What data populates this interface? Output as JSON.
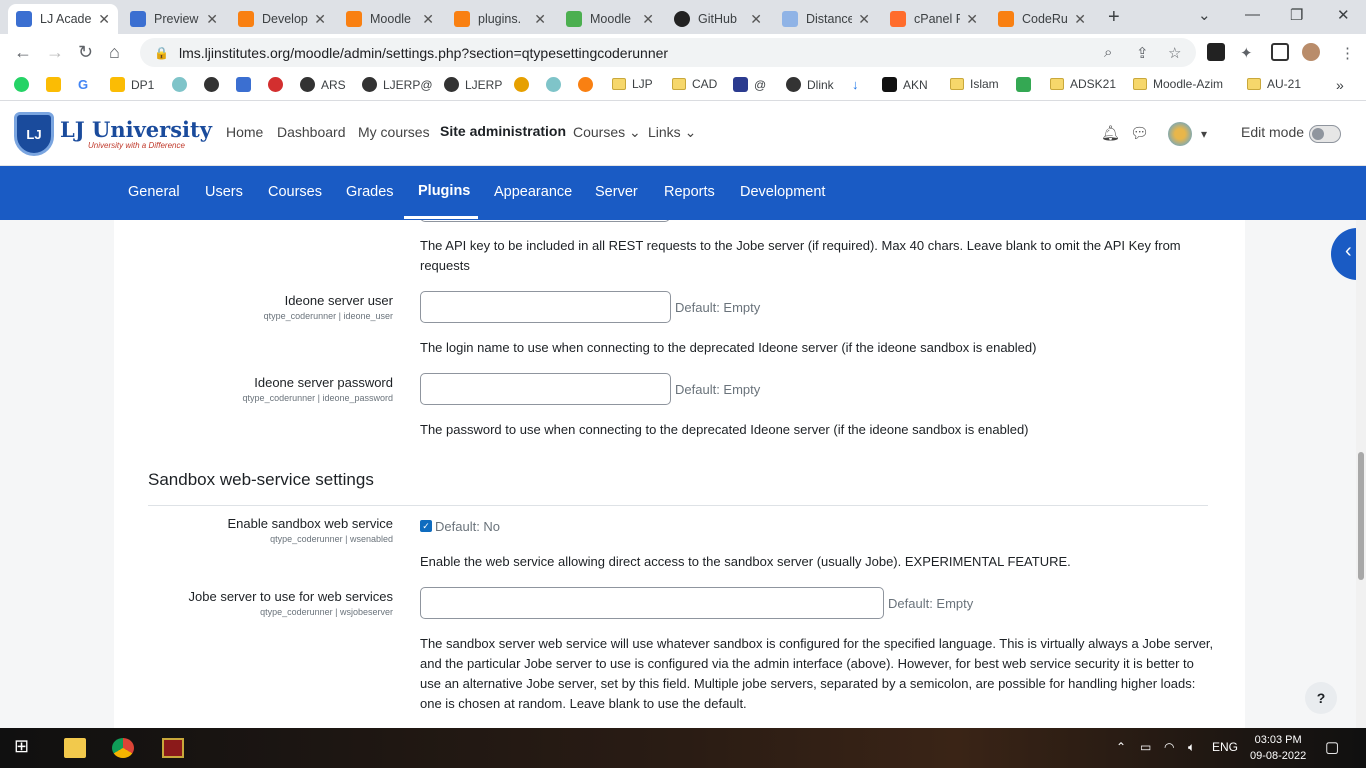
{
  "browser": {
    "tabs": [
      {
        "title": "LJ Acade",
        "active": true
      },
      {
        "title": "Preview"
      },
      {
        "title": "Develop"
      },
      {
        "title": "Moodle"
      },
      {
        "title": "plugins."
      },
      {
        "title": "Moodle"
      },
      {
        "title": "GitHub"
      },
      {
        "title": "Distance"
      },
      {
        "title": "cPanel F"
      },
      {
        "title": "CodeRu"
      }
    ],
    "url": "lms.ljinstitutes.org/moodle/admin/settings.php?section=qtypesettingcoderunner",
    "bookmarks": [
      "",
      "",
      "",
      "DP1",
      "",
      "",
      "",
      "",
      "ARS",
      "LJERP@",
      "LJERP",
      "",
      "",
      "",
      "LJP",
      "CAD",
      "@",
      "Dlink",
      "",
      "AKN",
      "Islam",
      "",
      "ADSK21",
      "Moodle-Azim",
      "AU-21"
    ]
  },
  "header": {
    "logo_name": "LJ University",
    "logo_tagline": "University with a Difference",
    "nav": [
      "Home",
      "Dashboard",
      "My courses",
      "Site administration",
      "Courses",
      "Links"
    ],
    "edit_mode_label": "Edit mode"
  },
  "secnav": [
    "General",
    "Users",
    "Courses",
    "Grades",
    "Plugins",
    "Appearance",
    "Server",
    "Reports",
    "Development"
  ],
  "settings": {
    "api_key_desc": "The API key to be included in all REST requests to the Jobe server (if required). Max 40 chars. Leave blank to omit the API Key from requests",
    "ideone_user": {
      "label": "Ideone server user",
      "sub": "qtype_coderunner | ideone_user",
      "default": "Default: Empty",
      "desc": "The login name to use when connecting to the deprecated Ideone server (if the ideone sandbox is enabled)"
    },
    "ideone_password": {
      "label": "Ideone server password",
      "sub": "qtype_coderunner | ideone_password",
      "default": "Default: Empty",
      "desc": "The password to use when connecting to the deprecated Ideone server (if the ideone sandbox is enabled)"
    },
    "section_title": "Sandbox web-service settings",
    "wsenabled": {
      "label": "Enable sandbox web service",
      "sub": "qtype_coderunner | wsenabled",
      "default": "Default: No",
      "desc": "Enable the web service allowing direct access to the sandbox server (usually Jobe). EXPERIMENTAL FEATURE."
    },
    "wsjobeserver": {
      "label": "Jobe server to use for web services",
      "sub": "qtype_coderunner | wsjobeserver",
      "default": "Default: Empty",
      "desc": "The sandbox server web service will use whatever sandbox is configured for the specified language. This is virtually always a Jobe server, and the particular Jobe server to use is configured via the admin interface (above). However, for best web service security it is better to use an alternative Jobe server, set by this field. Multiple jobe servers, separated by a semicolon, are possible for handling higher loads: one is chosen at random. Leave blank to use the default."
    }
  },
  "help_label": "?",
  "taskbar": {
    "lang": "ENG",
    "time": "03:03 PM",
    "date": "09-08-2022"
  }
}
